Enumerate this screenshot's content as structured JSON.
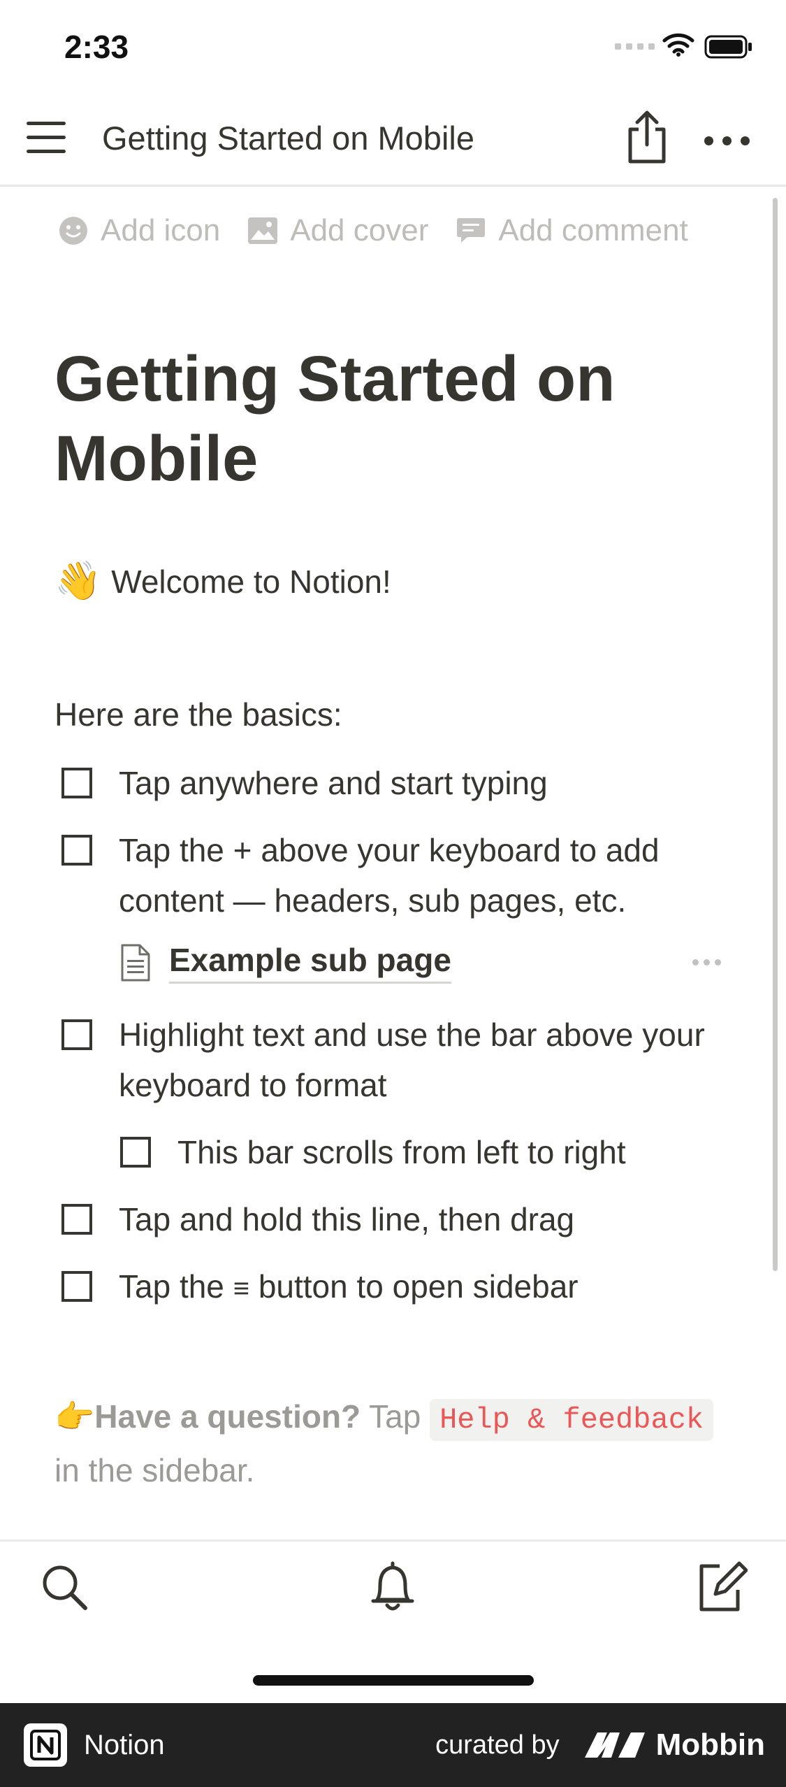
{
  "status_bar": {
    "time": "2:33"
  },
  "nav": {
    "title": "Getting Started on Mobile"
  },
  "page_actions": {
    "add_icon": "Add icon",
    "add_cover": "Add cover",
    "add_comment": "Add comment"
  },
  "page": {
    "title": "Getting Started on Mobile",
    "welcome_emoji": "👋",
    "welcome_text": "Welcome to Notion!",
    "basics_heading": "Here are the basics:",
    "todos": [
      "Tap anywhere and start typing",
      "Tap the + above your keyboard to add content — headers, sub pages, etc.",
      "Highlight text and use the bar above your keyboard to format",
      "This bar scrolls from left to right",
      "Tap and hold this line, then drag"
    ],
    "todo_last_before": "Tap the",
    "todo_last_glyph": "≡",
    "todo_last_after": "button to open sidebar",
    "subpage_title": "Example sub page",
    "question_emoji": "👉",
    "question_bold": "Have a question?",
    "question_tap": "Tap",
    "question_code": "Help & feedback",
    "question_end": "in the sidebar."
  },
  "footer": {
    "app_name": "Notion",
    "curated_by": "curated by",
    "brand": "Mobbin"
  },
  "icons": [
    "menu-icon",
    "share-icon",
    "more-icon",
    "smiley-icon",
    "image-icon",
    "comment-icon",
    "page-icon",
    "search-icon",
    "bell-icon",
    "compose-icon"
  ]
}
